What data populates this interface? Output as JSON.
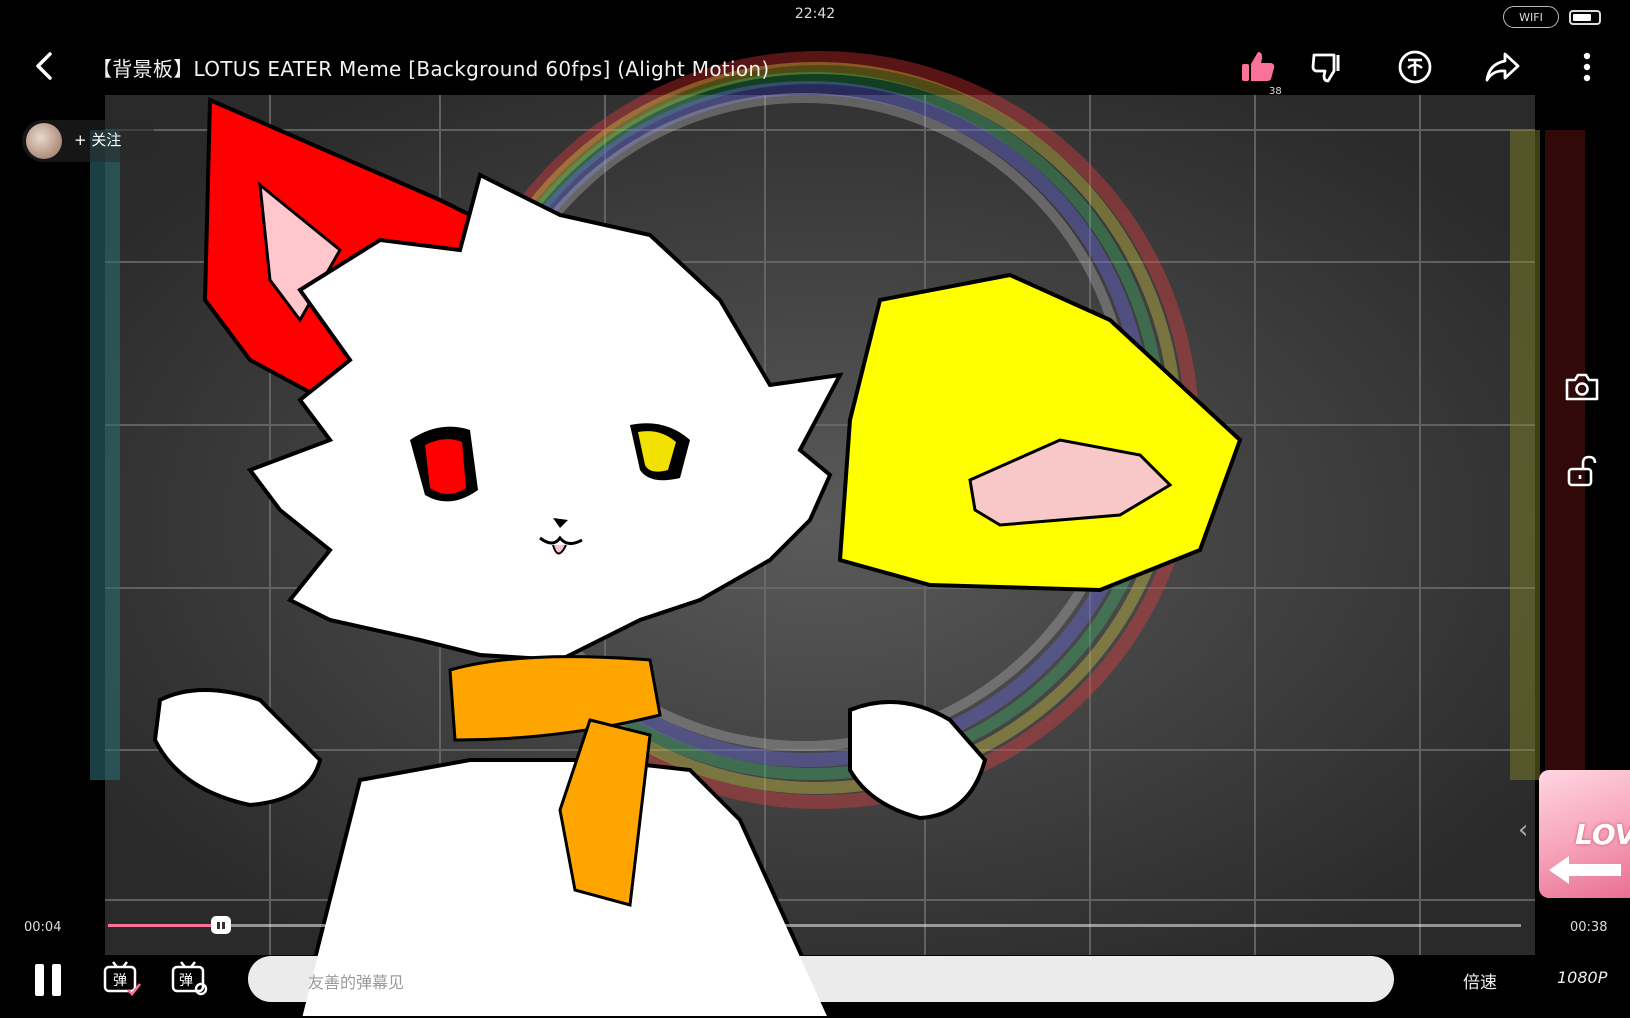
{
  "status": {
    "time": "22:42",
    "wifi": "WIFI"
  },
  "header": {
    "title": "【背景板】LOTUS EATER Meme [Background 60fps] (Alight Motion)",
    "like_count": "38"
  },
  "uploader": {
    "follow_label": "+ 关注"
  },
  "player": {
    "current_time": "00:04",
    "duration": "00:38",
    "progress": 0.08,
    "accent_color": "#fb7299"
  },
  "controls": {
    "danmaku_placeholder": "友善的弹幕见",
    "speed_label": "倍速",
    "quality_label": "1080P"
  },
  "ad": {
    "text": "LOV"
  },
  "icons": [
    "back-icon",
    "thumbs-up-icon",
    "thumbs-down-icon",
    "coin-icon",
    "share-icon",
    "more-icon",
    "camera-icon",
    "lock-icon",
    "danmaku-toggle-icon",
    "danmaku-settings-icon"
  ]
}
